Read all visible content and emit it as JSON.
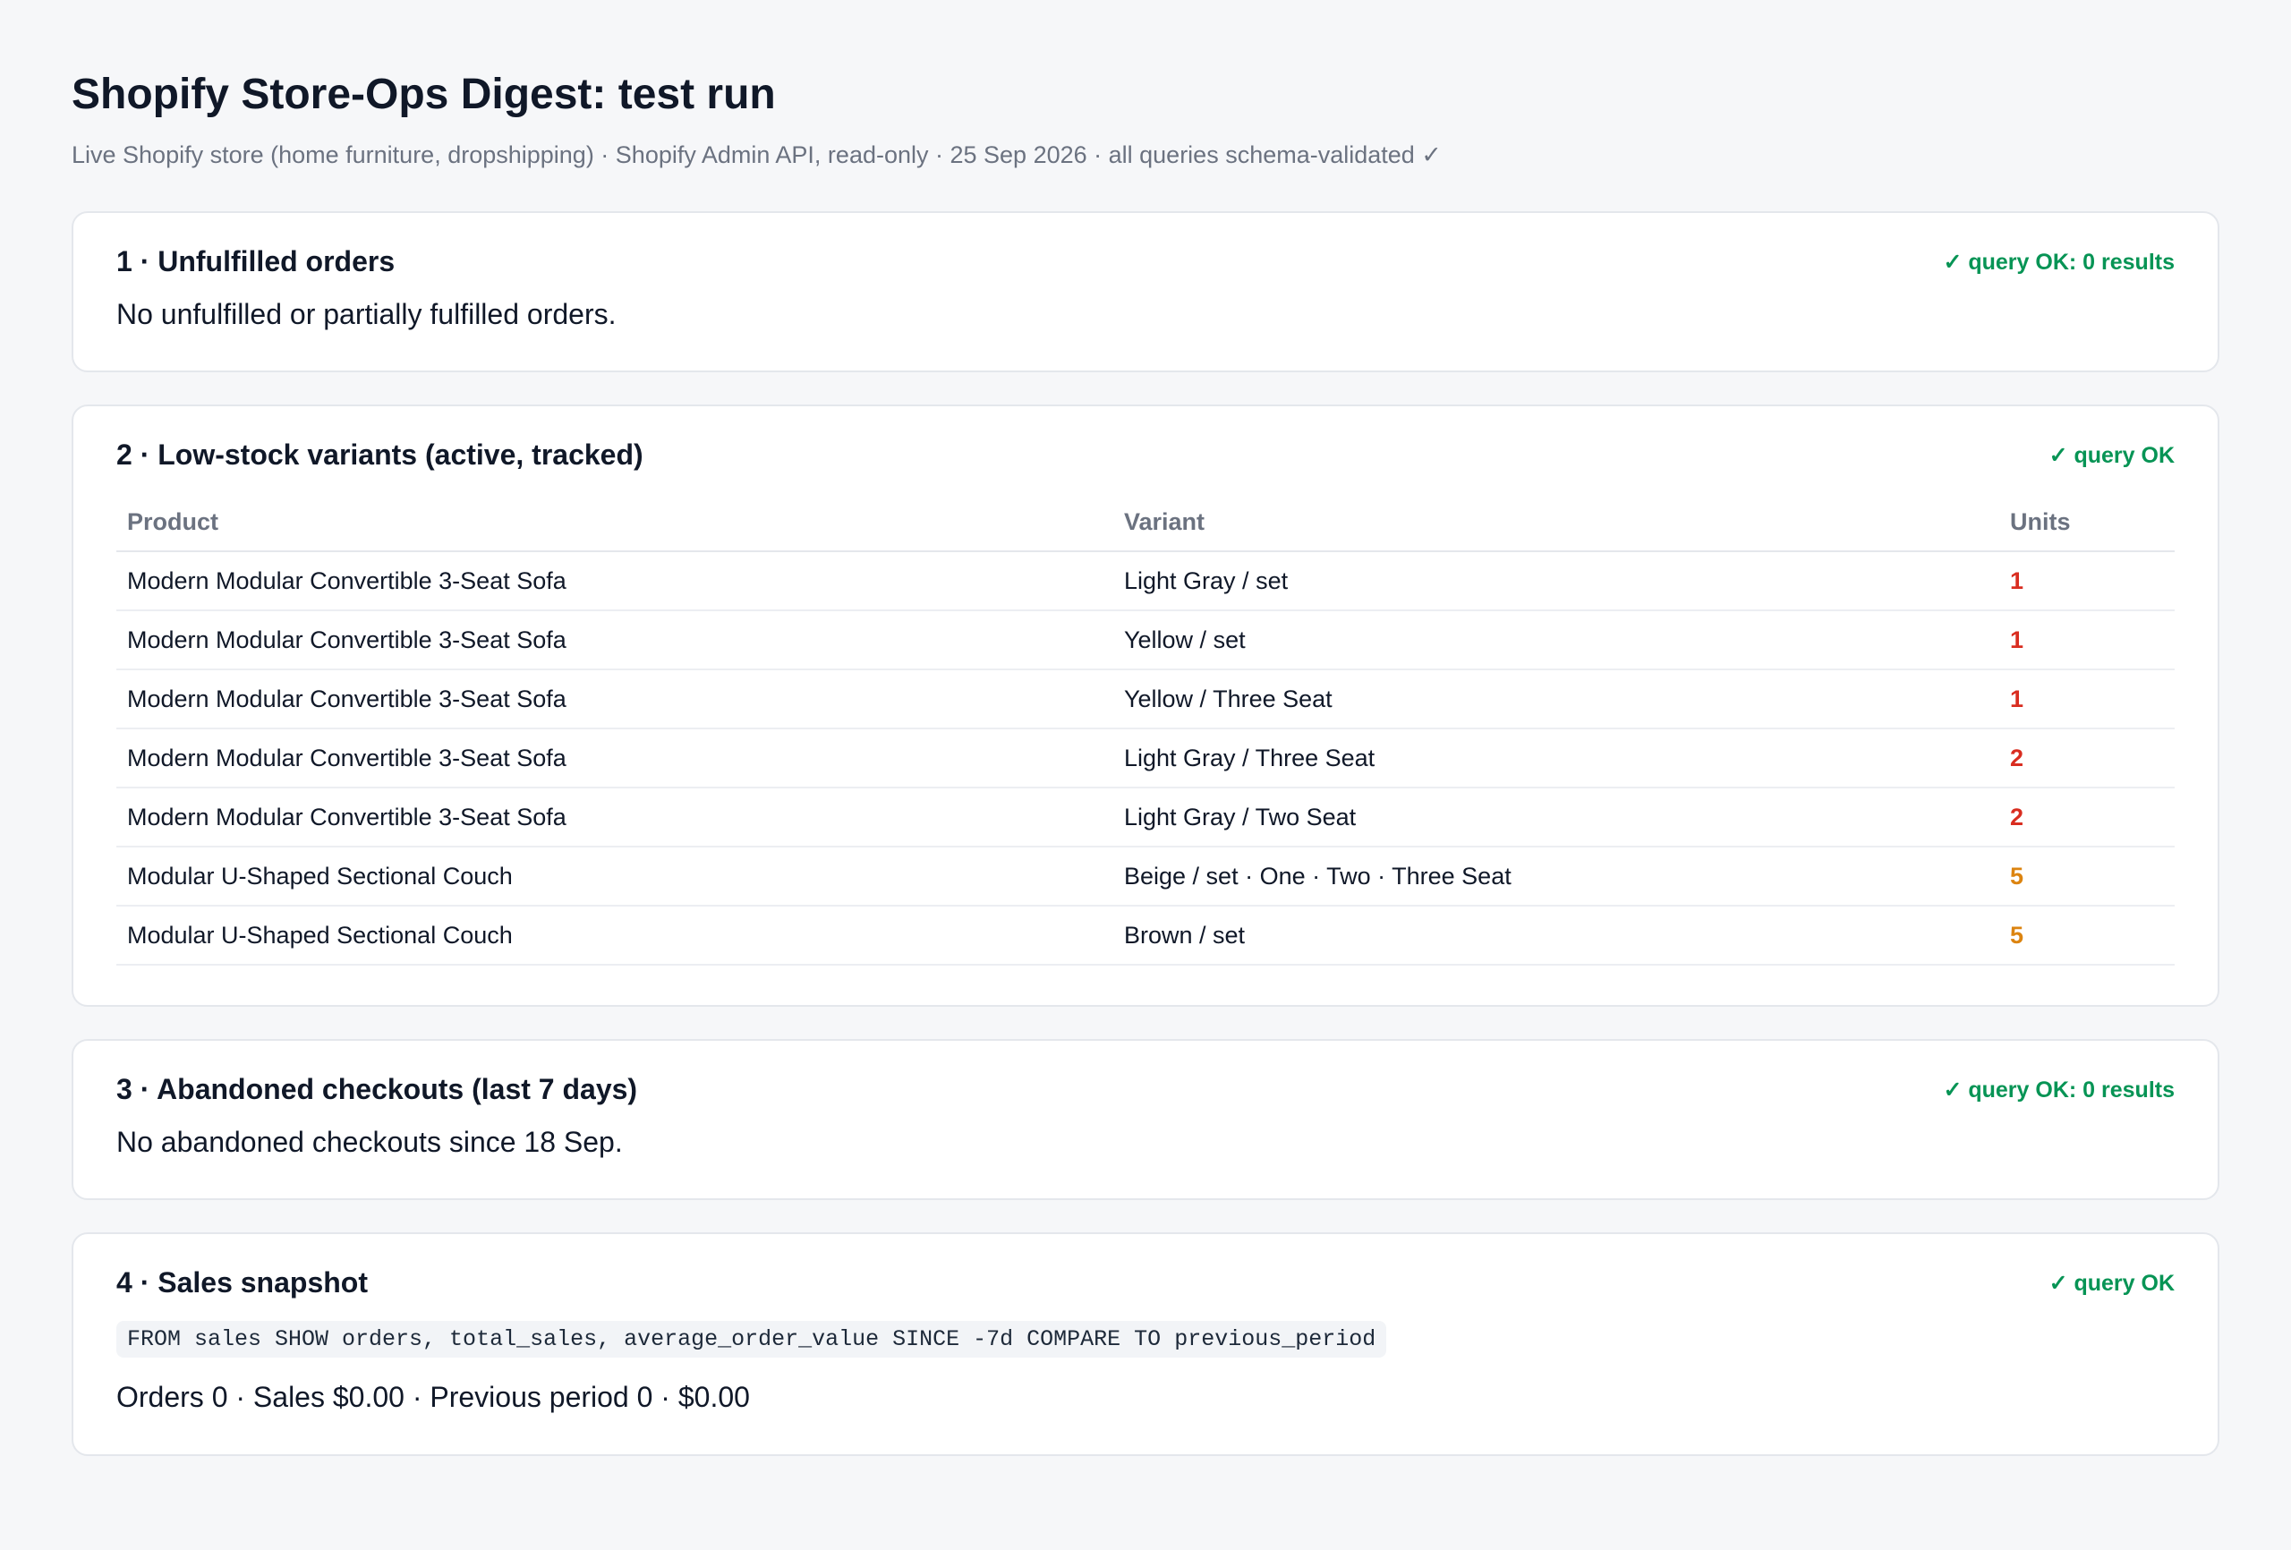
{
  "header": {
    "title": "Shopify Store-Ops Digest: test run",
    "subtitle": "Live Shopify store (home furniture, dropshipping) · Shopify Admin API, read-only · 25 Sep 2026 · all queries schema-validated ✓"
  },
  "sections": {
    "unfulfilled": {
      "title": "1 · Unfulfilled orders",
      "status": "✓ query OK: 0 results",
      "message": "No unfulfilled or partially fulfilled orders."
    },
    "low_stock": {
      "title": "2 · Low-stock variants (active, tracked)",
      "status": "✓ query OK",
      "columns": [
        "Product",
        "Variant",
        "Units"
      ],
      "rows": [
        {
          "product": "Modern Modular Convertible 3-Seat Sofa",
          "variant": "Light Gray / set",
          "units": "1"
        },
        {
          "product": "Modern Modular Convertible 3-Seat Sofa",
          "variant": "Yellow / set",
          "units": "1"
        },
        {
          "product": "Modern Modular Convertible 3-Seat Sofa",
          "variant": "Yellow / Three Seat",
          "units": "1"
        },
        {
          "product": "Modern Modular Convertible 3-Seat Sofa",
          "variant": "Light Gray / Three Seat",
          "units": "2"
        },
        {
          "product": "Modern Modular Convertible 3-Seat Sofa",
          "variant": "Light Gray / Two Seat",
          "units": "2"
        },
        {
          "product": "Modular U-Shaped Sectional Couch",
          "variant": "Beige / set · One · Two · Three Seat",
          "units": "5"
        },
        {
          "product": "Modular U-Shaped Sectional Couch",
          "variant": "Brown / set",
          "units": "5"
        }
      ]
    },
    "abandoned": {
      "title": "3 · Abandoned checkouts (last 7 days)",
      "status": "✓ query OK: 0 results",
      "message": "No abandoned checkouts since 18 Sep."
    },
    "sales": {
      "title": "4 · Sales snapshot",
      "status": "✓ query OK",
      "query": "FROM sales SHOW orders, total_sales, average_order_value SINCE -7d COMPARE TO previous_period",
      "summary": "Orders 0 · Sales $0.00 · Previous period 0 · $0.00"
    }
  },
  "colors": {
    "ok": "#079455",
    "units_critical": "#d92d20",
    "units_warning": "#dc8410"
  }
}
